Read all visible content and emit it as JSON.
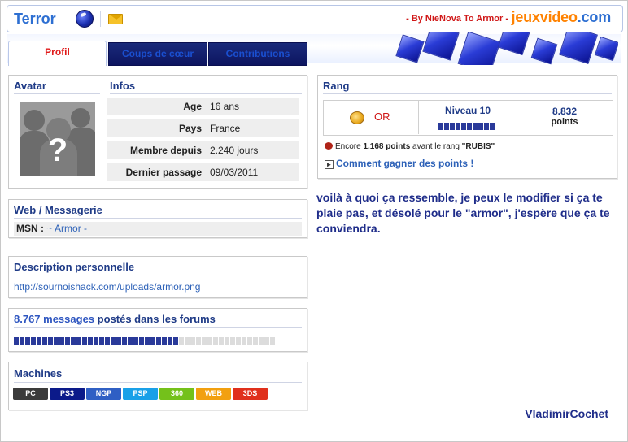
{
  "header": {
    "title": "Terror",
    "credit": "- By NieNova To Armor -",
    "brand_main": "jeuxvideo",
    "brand_tld": ".com"
  },
  "tabs": [
    {
      "label": "Profil",
      "active": true
    },
    {
      "label": "Coups de cœur",
      "active": false
    },
    {
      "label": "Contributions",
      "active": false
    }
  ],
  "avatar": {
    "heading": "Avatar",
    "placeholder_glyph": "?"
  },
  "infos": {
    "heading": "Infos",
    "rows": [
      {
        "key": "Age",
        "value": "16 ans"
      },
      {
        "key": "Pays",
        "value": "France"
      },
      {
        "key": "Membre depuis",
        "value": "2.240 jours"
      },
      {
        "key": "Dernier passage",
        "value": "09/03/2011"
      }
    ]
  },
  "web": {
    "heading": "Web / Messagerie",
    "msn_label": "MSN :",
    "msn_value": "~ Armor -"
  },
  "description": {
    "heading": "Description personnelle",
    "link": "http://sournoishack.com/uploads/armor.png"
  },
  "forum": {
    "count": "8.767 messages",
    "rest": " postés dans les forums",
    "progress_fraction": 0.63
  },
  "machines": {
    "heading": "Machines",
    "items": [
      {
        "label": "PC",
        "color": "#3b3b3b"
      },
      {
        "label": "PS3",
        "color": "#0b1a8a"
      },
      {
        "label": "NGP",
        "color": "#2f5fc4"
      },
      {
        "label": "PSP",
        "color": "#19a0e8"
      },
      {
        "label": "360",
        "color": "#74c11b"
      },
      {
        "label": "WEB",
        "color": "#f2a010"
      },
      {
        "label": "3DS",
        "color": "#e0301c"
      }
    ]
  },
  "rang": {
    "heading": "Rang",
    "rank_name": "OR",
    "level_label": "Niveau 10",
    "points_value": "8.832",
    "points_label": "points",
    "encore_prefix": "Encore ",
    "encore_points": "1.168 points",
    "encore_suffix": " avant le rang ",
    "next_rank": "\"RUBIS\"",
    "how_link": "Comment gagner des points !"
  },
  "message": "voilà à quoi ça ressemble, je peux le modifier si ça te plaie pas, et désolé pour le \"armor\", j'espère que ça te conviendra.",
  "signature": "VladimirCochet"
}
